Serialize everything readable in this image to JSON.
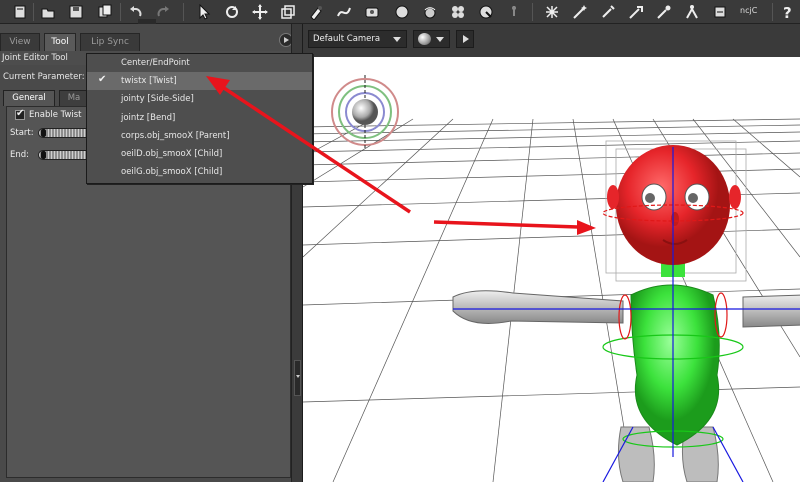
{
  "toolbar": {
    "icons": [
      "open-icon",
      "open-folder-icon",
      "save-icon",
      "copy-icon",
      "undo-icon",
      "redo-icon",
      "select-arrow-icon",
      "rotate-icon",
      "translate-icon",
      "scale-icon",
      "color-icon",
      "morph-icon",
      "grouping-icon",
      "sphere-icon",
      "taper-icon",
      "sphere-dot-icon",
      "direct-manipulation-icon",
      "twist-icon",
      "view-magnifier-icon",
      "wand-icon",
      "sparkle-icon",
      "pencil-icon",
      "brush-icon",
      "spray-icon",
      "figure-icon",
      "phone-icon",
      "help-icon"
    ],
    "user_label": "ncjC"
  },
  "left_panel": {
    "tabs": [
      {
        "label": "View",
        "active": false
      },
      {
        "label": "Tool",
        "active": true
      },
      {
        "label": "Lip Sync",
        "active": false
      }
    ],
    "tool_title": "Joint Editor Tool",
    "current_parameter_label": "Current Parameter:",
    "subtabs": [
      {
        "label": "General",
        "active": true
      },
      {
        "label": "Ma",
        "active": false
      }
    ],
    "enable_twist_label": "Enable Twist",
    "enable_twist_checked": true,
    "start_label": "Start:",
    "end_label": "End:"
  },
  "menu": {
    "items": [
      {
        "label": "Center/EndPoint",
        "selected": false
      },
      {
        "label": "twistx [Twist]",
        "selected": true
      },
      {
        "label": "jointy [Side-Side]",
        "selected": false
      },
      {
        "label": "jointz [Bend]",
        "selected": false
      },
      {
        "label": "corps.obj_smooX [Parent]",
        "selected": false
      },
      {
        "label": "oeilD.obj_smooX [Child]",
        "selected": false
      },
      {
        "label": "oeilG.obj_smooX [Child]",
        "selected": false
      }
    ]
  },
  "viewport": {
    "camera": "Default Camera"
  },
  "colors": {
    "annotation_arrow": "#e8141c",
    "head": "#e6252a",
    "body": "#3ce23c"
  }
}
